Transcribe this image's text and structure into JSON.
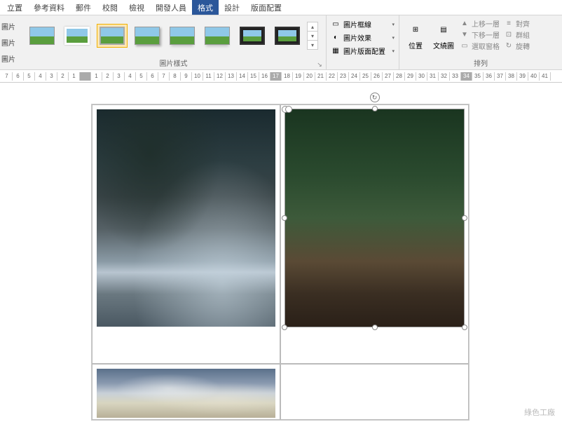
{
  "tabs": {
    "t0": "立置",
    "t1": "參考資料",
    "t2": "郵件",
    "t3": "校閱",
    "t4": "檢視",
    "t5": "開發人員",
    "t6": "格式",
    "t7": "設計",
    "t8": "版面配置"
  },
  "ribbon_left": {
    "r0": "圖片",
    "r1": "圖片",
    "r2": "圖片"
  },
  "group_labels": {
    "styles": "圖片樣式",
    "arrange": "排列"
  },
  "pic_opts": {
    "border": "圖片框線",
    "effects": "圖片效果",
    "layout": "圖片版面配置"
  },
  "arrange": {
    "position": "位置",
    "wrap": "文繞圖",
    "forward": "上移一層",
    "backward": "下移一層",
    "selection": "選取窗格",
    "align": "對齊",
    "group": "群組",
    "rotate": "旋轉"
  },
  "ruler_left": [
    "7",
    "6",
    "5",
    "4",
    "3",
    "2",
    "1"
  ],
  "ruler_right": [
    "1",
    "2",
    "3",
    "4",
    "5",
    "6",
    "7",
    "8",
    "9",
    "10",
    "11",
    "12",
    "13",
    "14",
    "15",
    "16",
    "17",
    "18",
    "19",
    "20",
    "21",
    "22",
    "23",
    "24",
    "25",
    "26",
    "27",
    "28",
    "29",
    "30",
    "31",
    "32",
    "33",
    "34",
    "35",
    "36",
    "37",
    "38",
    "39",
    "40",
    "41"
  ],
  "watermark": "綠色工廠"
}
